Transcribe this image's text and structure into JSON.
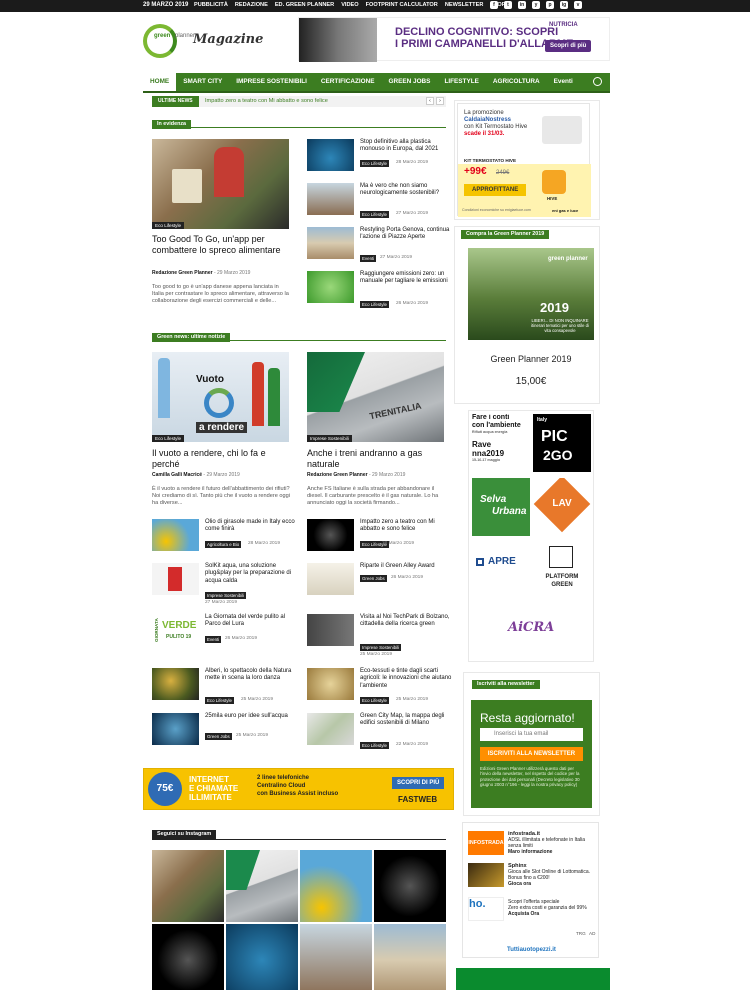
{
  "topbar": {
    "date": "29 MARZO 2019",
    "menu": [
      "PUBBLICITÀ",
      "REDAZIONE",
      "ED. GREEN PLANNER",
      "VIDEO",
      "FOOTPRINT CALCULATOR",
      "NEWSLETTER",
      "STORE"
    ],
    "social": [
      "f",
      "t",
      "in",
      "y",
      "p",
      "ig",
      "v"
    ]
  },
  "logo": {
    "green": "green",
    "planner": "planner",
    "magazine": "Magazine"
  },
  "header_ad": {
    "text1": "DECLINO COGNITIVO: SCOPRI",
    "text2": "I PRIMI CAMPANELLI D'ALLARME",
    "brand": "NUTRICIA",
    "cta": "Scopri di più"
  },
  "nav": {
    "items": [
      "HOME",
      "SMART CITY",
      "IMPRESE SOSTENIBILI",
      "CERTIFICAZIONE",
      "GREEN JOBS",
      "LIFESTYLE",
      "AGRICOLTURA",
      "Eventi"
    ]
  },
  "ticker": {
    "label": "ULTIME NEWS",
    "text": "Impatto zero a teatro con Mi abbatto e sono felice",
    "prev": "‹",
    "next": "›"
  },
  "evidenza": {
    "label": "In evidenza",
    "main": {
      "category": "Eco Lifestyle",
      "title": "Too Good To Go, un'app per combattere lo spreco alimentare",
      "author": "Redazione Green Planner",
      "date": "29 Marzo 2019",
      "excerpt": "Too good to go è un'app danese appena lanciata in Italia per contrastare lo spreco alimentare, attraverso la collaborazione degli esercizi commerciali e delle..."
    },
    "list": [
      {
        "title": "Stop definitivo alla plastica monouso in Europa, dal 2021",
        "badge": "Eco Lifestyle",
        "date": "28 Marzo 2019"
      },
      {
        "title": "Ma è vero che non siamo neurologicamente sostenibili?",
        "badge": "Eco Lifestyle",
        "date": "27 Marzo 2019"
      },
      {
        "title": "Restyling Porta Genova, continua l'azione di Piazze Aperte",
        "badge": "Eventi",
        "date": "27 Marzo 2019"
      },
      {
        "title": "Raggiungere emissioni zero: un manuale per tagliare le emissioni",
        "badge": "Eco Lifestyle",
        "date": "26 Marzo 2019"
      }
    ]
  },
  "green_news": {
    "label": "Green news: ultime notizie",
    "left": {
      "category": "Eco Lifestyle",
      "overlay1": "Vuoto",
      "overlay2": "a rendere",
      "title": "Il vuoto a rendere, chi lo fa e perché",
      "author": "Camilla Galli Macricé",
      "date": "29 Marzo 2019",
      "excerpt": "È il vuoto a rendere il futuro dell'abbattimento dei rifiuti? Noi crediamo di sì. Tanto più che il vuoto a rendere oggi ha diverse..."
    },
    "right": {
      "category": "Imprese Sostenibili",
      "title": "Anche i treni andranno a gas naturale",
      "author": "Redazione Green Planner",
      "date": "29 Marzo 2019",
      "excerpt": "Anche FS Italiane è sulla strada per abbandonare il diesel. Il carburante prescelto è il gas naturale. Lo ha annunciato oggi la società firmando...",
      "train": "TRENITALIA"
    },
    "left_list": [
      {
        "title": "Olio di girasole made in Italy ecco come finirà",
        "badge": "Agricoltura e Bio",
        "date": "28 Marzo 2019"
      },
      {
        "title": "SolKit aqua, una soluzione plug&play per la preparazione di acqua calda",
        "badge": "Imprese Sostenibili",
        "date": "27 Marzo 2019"
      },
      {
        "title": "La Giornata del verde pulito al Parco del Lura",
        "badge": "Eventi",
        "date": "26 Marzo 2019"
      },
      {
        "title": "Alberi, lo spettacolo della Natura mette in scena la loro danza",
        "badge": "Eco Lifestyle",
        "date": "25 Marzo 2019"
      },
      {
        "title": "25mila euro per idee sull'acqua",
        "badge": "Green Jobs",
        "date": "25 Marzo 2019"
      }
    ],
    "right_list": [
      {
        "title": "Impatto zero a teatro con Mi abbatto e sono felice",
        "badge": "Eco Lifestyle",
        "date": "28 Marzo 2019"
      },
      {
        "title": "Riparte il Green Alley Award",
        "badge": "Green Jobs",
        "date": "26 Marzo 2019"
      },
      {
        "title": "Visita al Noi TechPark di Bolzano, cittadella della ricerca green",
        "badge": "Imprese Sostenibili",
        "date": "25 Marzo 2019"
      },
      {
        "title": "Eco-tessuti e tinte dagli scarti agricoli: le innovazioni che aiutano l'ambiente",
        "badge": "Eco Lifestyle",
        "date": "25 Marzo 2019"
      },
      {
        "title": "Green City Map, la mappa degli edifici sostenibili di Milano",
        "badge": "Eco Lifestyle",
        "date": "22 Marzo 2019"
      }
    ],
    "verde": {
      "a": "GIORNATA",
      "b": "VERDE",
      "c": "PULITO 19"
    }
  },
  "side_ad": {
    "line1": "La promozione",
    "line2": "CaldaiaNostress",
    "line3": "con Kit Termostato Hive",
    "line4": "scade il 31/03.",
    "kit": "KIT TERMOSTATO HIVE",
    "price": "+99€",
    "old": "249€",
    "cta": "APPROFITTANE",
    "hive": "HIVE",
    "fine": "Condizioni economiche su enigiaeluce.com",
    "brand": "eni gas e luce"
  },
  "shop": {
    "label": "Compra la Green Planner 2019",
    "book_brand": "green planner",
    "year": "2019",
    "book_sub": "LIBERI... DI NON INQUINARE itinerari tematici per uno stile di vita consapevole",
    "name": "Green Planner 2019",
    "price": "15,00€"
  },
  "sponsors": {
    "fare1": "Fare i conti",
    "fare2": "con l'ambiente",
    "fare_sub": "Rifiuti acqua energia",
    "raven": "Rave",
    "raven2": "nna2019",
    "maggio": "15-16-17 maggio",
    "pic": "PIC",
    "pic2": "2GO",
    "italy": "Italy",
    "selva": "Selva",
    "selva2": "Urbana",
    "lav": "LAV",
    "apre": "APRE",
    "platform": "PLATFORM",
    "platform2": "GREEN",
    "aicra": "AiCRA"
  },
  "newsletter": {
    "label": "Iscriviti alla newsletter",
    "heading": "Resta aggiornato!",
    "placeholder": "Inserisci la tua email",
    "button": "ISCRIVITI ALLA NEWSLETTER",
    "fine": "Edizioni Green Planner utilizzerà questo dati per l'invio della newsletter, nel rispetto del codice per la protezione dei dati personali (Decreto legislativo 30 giugno 2003 n°196 - leggi la nostra privacy policy)"
  },
  "bottom_ad": {
    "sconto": "75€",
    "scontolab": "SCONTO",
    "a1": "INTERNET",
    "a2": "E CHIAMATE",
    "a3": "ILLIMITATE",
    "b1": "2 linee telefoniche",
    "b2": "Centralino Cloud",
    "b3": "con Business Assist incluso",
    "cta": "SCOPRI DI PIÙ",
    "brand": "FASTWEB"
  },
  "instagram": {
    "label": "Seguici su Instagram"
  },
  "right_ad2": {
    "infostrada": "INFOSTRADA",
    "t1a": "infostrada.it",
    "t1b": "ADSL illimitata e telefonate in Italia senza limiti",
    "t1c": "Maro informazione",
    "t2a": "Sphinx",
    "t2b": "Gioca alle Slot Online di Lottomatica. Bonus fino a €200!",
    "t2c": "Gioca ora",
    "t3a": "Scopri l'offerta speciale",
    "t3b": "Zero extra costi e garanzia del 99%",
    "t3c": "Acquista Ora",
    "ho": "ho.",
    "footer": "Tuttiauotopezzi.it",
    "trg": "TRG",
    "ad": "AD"
  }
}
